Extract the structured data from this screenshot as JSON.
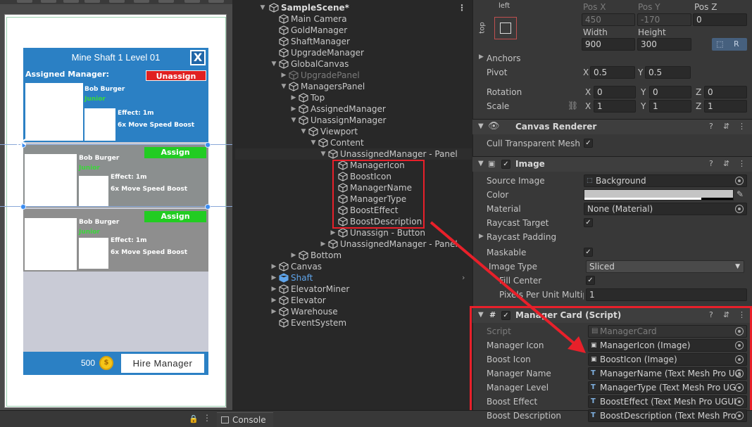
{
  "game": {
    "panel_title": "Mine Shaft 1 Level 01",
    "close_label": "X",
    "assigned_label": "Assigned Manager:",
    "unassign_label": "Unassign",
    "assign_label": "Assign",
    "manager_name": "Bob Burger",
    "manager_type": "Junior",
    "effect": "Effect: 1m",
    "description": "6x Move Speed Boost",
    "money": "500",
    "hire_label": "Hire Manager"
  },
  "bottom": {
    "console_label": "Console"
  },
  "hierarchy": {
    "rows": [
      {
        "label": "SampleScene*",
        "indent": 0,
        "style": "bold",
        "arrow": "▼",
        "icon": "unity"
      },
      {
        "label": "Main Camera",
        "indent": 1,
        "arrow": ""
      },
      {
        "label": "GoldManager",
        "indent": 1,
        "arrow": ""
      },
      {
        "label": "ShaftManager",
        "indent": 1,
        "arrow": ""
      },
      {
        "label": "UpgradeManager",
        "indent": 1,
        "arrow": ""
      },
      {
        "label": "GlobalCanvas",
        "indent": 1,
        "arrow": "▼"
      },
      {
        "label": "UpgradePanel",
        "indent": 2,
        "arrow": "▶",
        "style": "dim"
      },
      {
        "label": "ManagersPanel",
        "indent": 2,
        "arrow": "▼"
      },
      {
        "label": "Top",
        "indent": 3,
        "arrow": "▶"
      },
      {
        "label": "AssignedManager",
        "indent": 3,
        "arrow": "▶"
      },
      {
        "label": "UnassignManager",
        "indent": 3,
        "arrow": "▼"
      },
      {
        "label": "Viewport",
        "indent": 4,
        "arrow": "▼"
      },
      {
        "label": "Content",
        "indent": 5,
        "arrow": "▼"
      },
      {
        "label": "UnassignedManager - Panel",
        "indent": 6,
        "arrow": "▼",
        "selected": true
      },
      {
        "label": "ManagerIcon",
        "indent": 7,
        "arrow": ""
      },
      {
        "label": "BoostIcon",
        "indent": 7,
        "arrow": ""
      },
      {
        "label": "ManagerName",
        "indent": 7,
        "arrow": ""
      },
      {
        "label": "ManagerType",
        "indent": 7,
        "arrow": ""
      },
      {
        "label": "BoostEffect",
        "indent": 7,
        "arrow": ""
      },
      {
        "label": "BoostDescription",
        "indent": 7,
        "arrow": ""
      },
      {
        "label": "Unassign - Button",
        "indent": 7,
        "arrow": "▶"
      },
      {
        "label": "UnassignedManager - Panel",
        "indent": 6,
        "arrow": "▶"
      },
      {
        "label": "Bottom",
        "indent": 3,
        "arrow": "▶"
      },
      {
        "label": "Canvas",
        "indent": 1,
        "arrow": "▶"
      },
      {
        "label": "Shaft",
        "indent": 1,
        "arrow": "▶",
        "style": "blue"
      },
      {
        "label": "ElevatorMiner",
        "indent": 1,
        "arrow": "▶"
      },
      {
        "label": "Elevator",
        "indent": 1,
        "arrow": "▶"
      },
      {
        "label": "Warehouse",
        "indent": 1,
        "arrow": "▶"
      },
      {
        "label": "EventSystem",
        "indent": 1,
        "arrow": ""
      }
    ]
  },
  "inspector": {
    "anchor_left": "left",
    "anchor_top": "top",
    "pos_x_label": "Pos X",
    "pos_y_label": "Pos Y",
    "pos_z_label": "Pos Z",
    "pos_x": "450",
    "pos_y": "-170",
    "pos_z": "0",
    "width_label": "Width",
    "height_label": "Height",
    "width": "900",
    "height": "300",
    "blueprint_r": "R",
    "anchors_label": "Anchors",
    "pivot_label": "Pivot",
    "pivot_x": "0.5",
    "pivot_y": "0.5",
    "rotation_label": "Rotation",
    "rot_x": "0",
    "rot_y": "0",
    "rot_z": "0",
    "scale_label": "Scale",
    "scale_x": "1",
    "scale_y": "1",
    "scale_z": "1",
    "x": "X",
    "y": "Y",
    "z": "Z",
    "canvas_renderer_title": "Canvas Renderer",
    "cull_label": "Cull Transparent Mesh",
    "image_title": "Image",
    "source_image_label": "Source Image",
    "source_image": "Background",
    "color_label": "Color",
    "material_label": "Material",
    "material": "None (Material)",
    "raycast_target_label": "Raycast Target",
    "raycast_padding_label": "Raycast Padding",
    "maskable_label": "Maskable",
    "image_type_label": "Image Type",
    "image_type": "Sliced",
    "fill_center_label": "Fill Center",
    "ppu_label": "Pixels Per Unit Multipl",
    "ppu": "1",
    "script_title": "Manager Card (Script)",
    "script_label": "Script",
    "script_value": "ManagerCard",
    "manager_icon_label": "Manager Icon",
    "manager_icon_value": "ManagerIcon (Image)",
    "boost_icon_label": "Boost Icon",
    "boost_icon_value": "BoostIcon (Image)",
    "manager_name_label": "Manager Name",
    "manager_name_value": "ManagerName (Text Mesh Pro UG",
    "manager_level_label": "Manager Level",
    "manager_level_value": "ManagerType (Text Mesh Pro UG",
    "boost_effect_label": "Boost Effect",
    "boost_effect_value": "BoostEffect (Text Mesh Pro UGUI",
    "boost_desc_label": "Boost Description",
    "boost_desc_value": "BoostDescription (Text Mesh Pro"
  },
  "colors": {
    "panel_blue": "#2b80c4",
    "assign_green": "#22cc22",
    "unassign_red": "#e02020",
    "annotation_red": "#e8202a"
  }
}
